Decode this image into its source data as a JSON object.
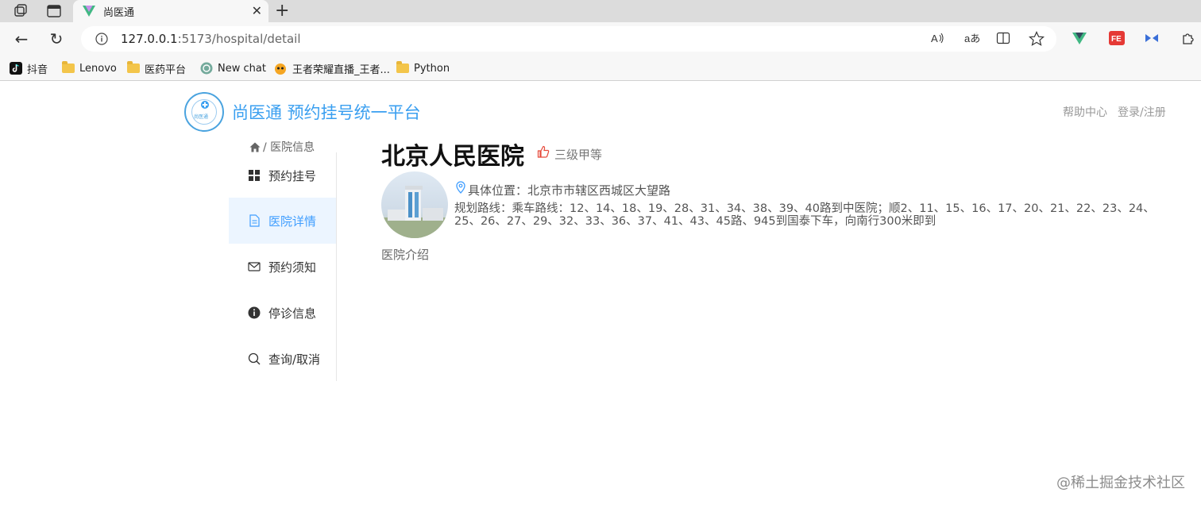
{
  "browser": {
    "tab_title": "尚医通",
    "url_host": "127.0.0.1",
    "url_path": ":5173/hospital/detail",
    "bookmarks": [
      "抖音",
      "Lenovo",
      "医药平台",
      "New chat",
      "王者荣耀直播_王者...",
      "Python"
    ]
  },
  "header": {
    "logo_text": "尚医通",
    "title": "尚医通 预约挂号统一平台",
    "help": "帮助中心",
    "login": "登录/注册"
  },
  "breadcrumb": {
    "label": "/ 医院信息"
  },
  "menu": {
    "items": [
      {
        "label": "预约挂号",
        "icon": "grid-icon"
      },
      {
        "label": "医院详情",
        "icon": "document-icon",
        "active": true
      },
      {
        "label": "预约须知",
        "icon": "mail-icon"
      },
      {
        "label": "停诊信息",
        "icon": "info-icon"
      },
      {
        "label": "查询/取消",
        "icon": "search-icon"
      }
    ]
  },
  "hospital": {
    "name": "北京人民医院",
    "level": "三级甲等",
    "address": "具体位置：北京市市辖区西城区大望路",
    "route": "规划路线：乘车路线：12、14、18、19、28、31、34、38、39、40路到中医院；顺2、11、15、16、17、20、21、22、23、24、25、26、27、29、32、33、36、37、41、43、45路、945到国泰下车，向南行300米即到",
    "intro_label": "医院介绍"
  },
  "watermark": "@稀土掘金技术社区",
  "colors": {
    "accent": "#409eff",
    "title_blue": "#3a9ff0",
    "active_bg": "#ecf5ff"
  }
}
